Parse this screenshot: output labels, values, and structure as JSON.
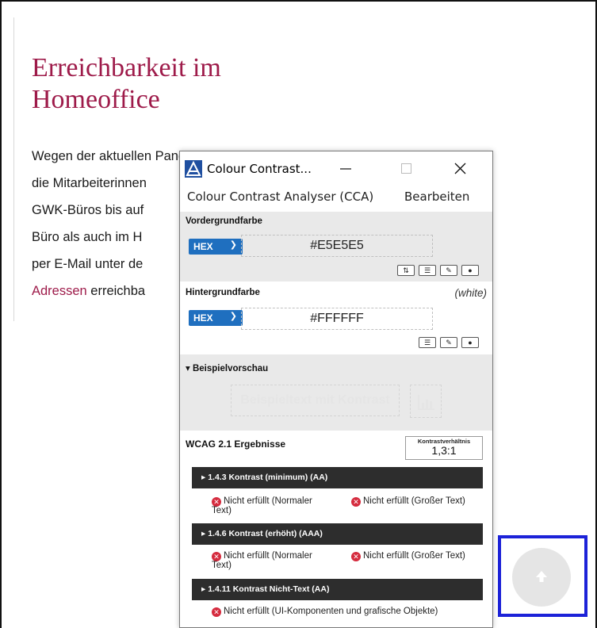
{
  "page": {
    "title": "Erreichbarkeit im Homeoffice",
    "body_lines": [
      "Wegen der aktuellen Pandemie-Lage sind",
      "die Mitarbeiterinnen",
      "GWK-Büros bis auf",
      "Büro als auch im H",
      "per E-Mail unter de"
    ],
    "link_text": "Adressen",
    "last_line_rest": " erreichba",
    "title_color": "#9e1b4a",
    "scroll_top_icon": "arrow-up-icon"
  },
  "cca": {
    "window_title": "Colour Contrast...",
    "menu": {
      "app": "Colour Contrast Analyser (CCA)",
      "edit": "Bearbeiten"
    },
    "foreground": {
      "label": "Vordergrundfarbe",
      "format": "HEX",
      "value": "#E5E5E5",
      "tools": [
        "swap-icon",
        "sliders-icon",
        "eyedropper-icon",
        "help-icon"
      ]
    },
    "background": {
      "label": "Hintergrundfarbe",
      "name": "(white)",
      "format": "HEX",
      "value": "#FFFFFF",
      "tools": [
        "sliders-icon",
        "eyedropper-icon",
        "help-icon"
      ]
    },
    "preview": {
      "label": "▾ Beispielvorschau",
      "text": "Beispieltext mit Kontrast"
    },
    "results": {
      "label": "WCAG 2.1 Ergebnisse",
      "ratio_caption": "Kontrastverhältnis",
      "ratio": "1,3:1",
      "criteria": [
        {
          "title": "▸ 1.4.3 Kontrast (minimum) (AA)",
          "normal": "Nicht erfüllt (Normaler Text)",
          "large": "Nicht erfüllt (Großer Text)"
        },
        {
          "title": "▸ 1.4.6 Kontrast (erhöht) (AAA)",
          "normal": "Nicht erfüllt (Normaler Text)",
          "large": "Nicht erfüllt (Großer Text)"
        },
        {
          "title": "▸ 1.4.11 Kontrast Nicht-Text (AA)",
          "normal": "Nicht erfüllt (UI-Komponenten und grafische Objekte)"
        }
      ]
    },
    "colors": {
      "hex_select": "#1f6fbf",
      "fail": "#d52b3e",
      "criterion_bg": "#2d2d2d"
    }
  },
  "focus_color": "#1c22d8"
}
